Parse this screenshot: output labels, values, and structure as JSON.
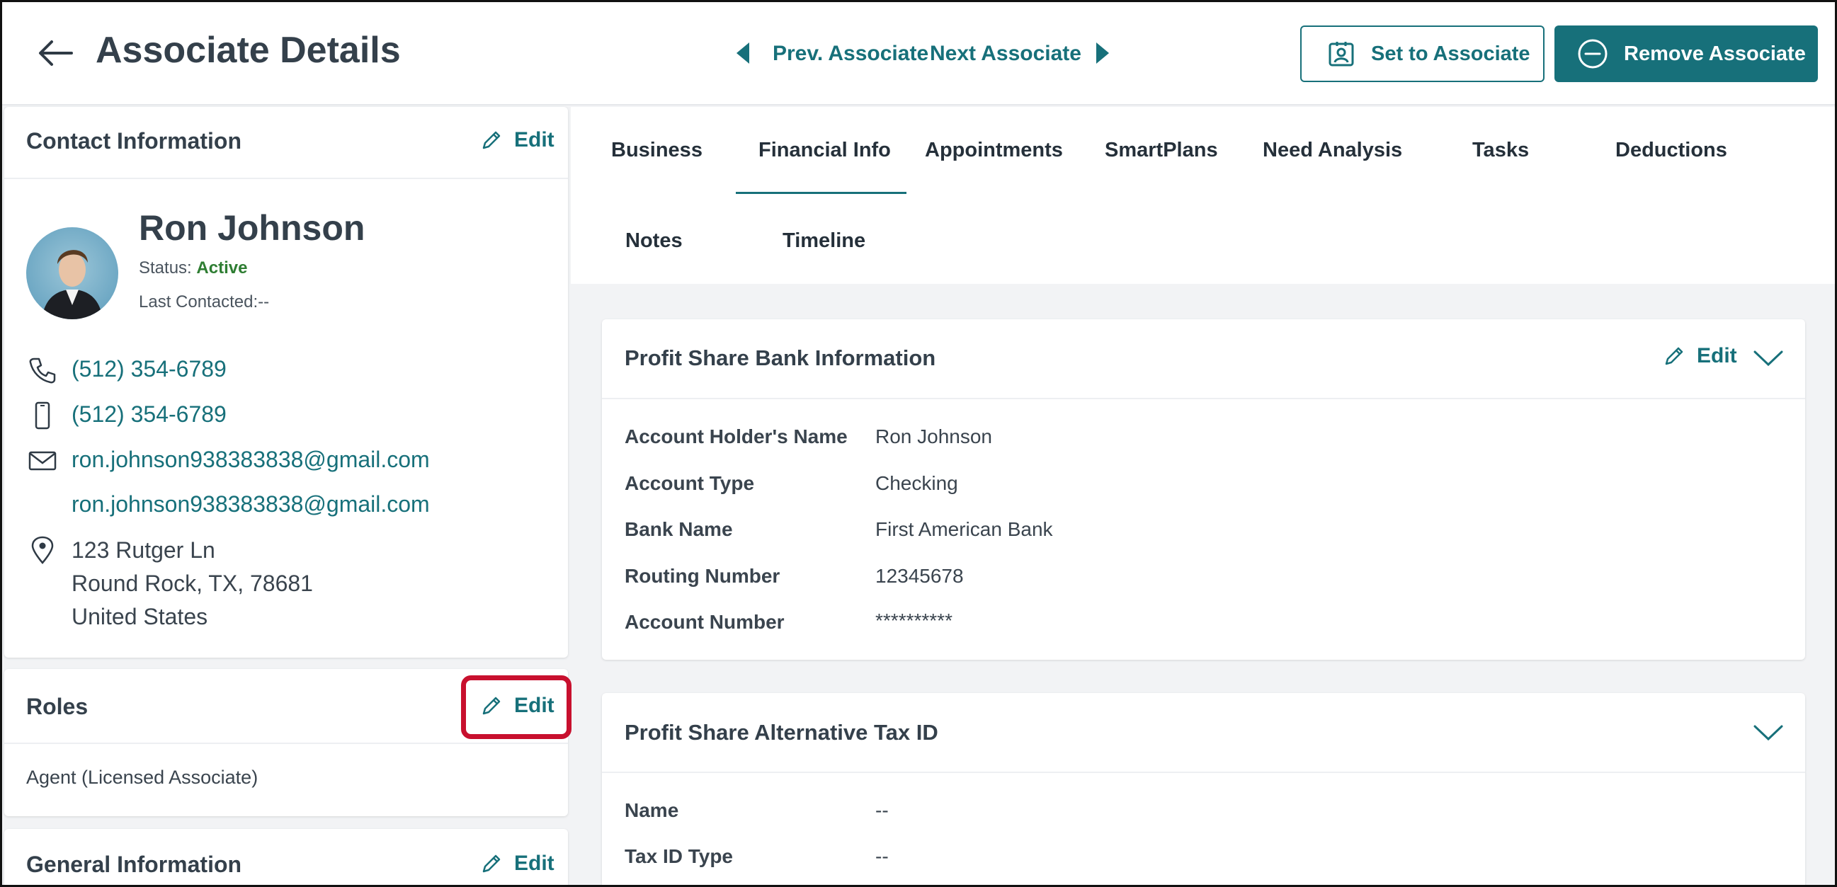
{
  "header": {
    "title": "Associate Details",
    "prev_label": "Prev. Associate",
    "next_label": "Next Associate",
    "set_button": "Set to Associate",
    "remove_button": "Remove Associate"
  },
  "contact": {
    "title": "Contact Information",
    "edit": "Edit",
    "name": "Ron Johnson",
    "status_label": "Status:",
    "status_value": "Active",
    "last_contacted": "Last Contacted:--",
    "phone": "(512) 354-6789",
    "mobile": "(512) 354-6789",
    "email_1": "ron.johnson938383838@gmail.com",
    "email_2": "ron.johnson938383838@gmail.com",
    "address_line1": "123 Rutger Ln",
    "address_line2": "Round Rock, TX, 78681",
    "address_line3": "United States"
  },
  "roles": {
    "title": "Roles",
    "edit": "Edit",
    "value": "Agent (Licensed Associate)"
  },
  "general": {
    "title": "General Information",
    "edit": "Edit"
  },
  "tabs": [
    {
      "label": "Business"
    },
    {
      "label": "Financial Info",
      "active": true
    },
    {
      "label": "Appointments"
    },
    {
      "label": "SmartPlans"
    },
    {
      "label": "Need Analysis"
    },
    {
      "label": "Tasks"
    },
    {
      "label": "Deductions"
    },
    {
      "label": "Notes"
    },
    {
      "label": "Timeline"
    }
  ],
  "bank_info": {
    "title": "Profit Share Bank Information",
    "edit": "Edit",
    "fields": [
      {
        "label": "Account Holder's Name",
        "value": "Ron Johnson"
      },
      {
        "label": "Account Type",
        "value": "Checking"
      },
      {
        "label": "Bank Name",
        "value": "First American Bank"
      },
      {
        "label": "Routing Number",
        "value": "12345678"
      },
      {
        "label": "Account Number",
        "value": "**********"
      }
    ]
  },
  "alt_tax": {
    "title": "Profit Share Alternative Tax ID",
    "fields": [
      {
        "label": "Name",
        "value": "--"
      },
      {
        "label": "Tax ID Type",
        "value": "--"
      }
    ]
  },
  "colors": {
    "accent": "#17707a",
    "status_active": "#2e7d32",
    "highlight": "#c8102e"
  }
}
